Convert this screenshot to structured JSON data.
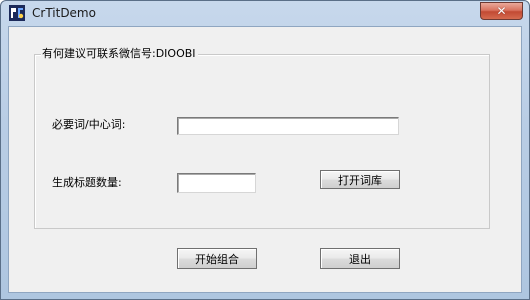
{
  "window": {
    "title": "CrTitDemo",
    "app_icon": "crtitdemo-app-icon",
    "close_icon": "close-icon",
    "close_glyph": "✕"
  },
  "group": {
    "legend": "有何建议可联系微信号:DIOOBI"
  },
  "form": {
    "keyword_label": "必要词/中心词:",
    "keyword_value": "",
    "count_label": "生成标题数量:",
    "count_value": ""
  },
  "buttons": {
    "open_library": "打开词库",
    "start_combine": "开始组合",
    "exit": "退出"
  },
  "colors": {
    "title_bar": "#b9cde5",
    "close_button": "#c24a33",
    "client_background": "#f0f0f0"
  }
}
